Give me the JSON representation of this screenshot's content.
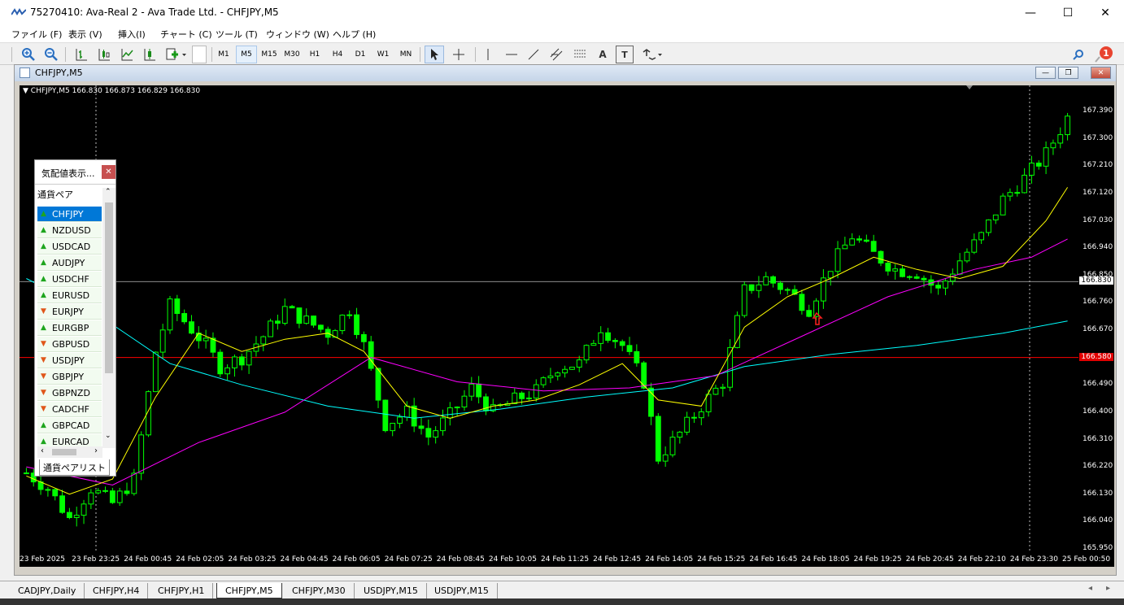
{
  "window": {
    "title": "75270410: Ava-Real 2 - Ava Trade Ltd. - CHFJPY,M5"
  },
  "menu": [
    "ファイル (F)",
    "表示 (V)",
    "挿入(I)",
    "チャート (C)",
    "ツール (T)",
    "ウィンドウ (W)",
    "ヘルプ (H)"
  ],
  "timeframes": [
    "M1",
    "M5",
    "M15",
    "M30",
    "H1",
    "H4",
    "D1",
    "W1",
    "MN"
  ],
  "active_timeframe": "M5",
  "tool_labels": {
    "text": "A",
    "label": "T"
  },
  "notification_count": "1",
  "chart_window": {
    "title": "CHFJPY,M5"
  },
  "chart": {
    "info": "CHFJPY,M5  166.830 166.873 166.829 166.830",
    "current_price": "166.830",
    "line_price": "166.580",
    "colors": {
      "bull": "#00ff00",
      "ma_fast": "#ffff00",
      "ma_mid": "#ff00ff",
      "ma_slow": "#00ffff",
      "hline": "#ff0000",
      "bid_line": "#c0c0c0"
    }
  },
  "chart_data": {
    "type": "candlestick",
    "symbol": "CHFJPY",
    "timeframe": "M5",
    "y_ticks": [
      "167.390",
      "167.300",
      "167.210",
      "167.120",
      "167.030",
      "166.940",
      "166.850",
      "166.760",
      "166.670",
      "166.580",
      "166.490",
      "166.400",
      "166.310",
      "166.220",
      "166.130",
      "166.040",
      "165.950"
    ],
    "ylim": [
      165.95,
      167.39
    ],
    "x_ticks": [
      "23 Feb 2025",
      "23 Feb 23:25",
      "24 Feb 00:45",
      "24 Feb 02:05",
      "24 Feb 03:25",
      "24 Feb 04:45",
      "24 Feb 06:05",
      "24 Feb 07:25",
      "24 Feb 08:45",
      "24 Feb 10:05",
      "24 Feb 11:25",
      "24 Feb 12:45",
      "24 Feb 14:05",
      "24 Feb 15:25",
      "24 Feb 16:45",
      "24 Feb 18:05",
      "24 Feb 19:25",
      "24 Feb 20:45",
      "24 Feb 22:10",
      "24 Feb 23:30",
      "25 Feb 00:50"
    ],
    "price_path": [
      [
        0,
        166.2
      ],
      [
        3,
        166.15
      ],
      [
        6,
        166.05
      ],
      [
        9,
        166.15
      ],
      [
        12,
        166.1
      ],
      [
        15,
        166.18
      ],
      [
        18,
        166.6
      ],
      [
        20,
        166.75
      ],
      [
        22,
        166.7
      ],
      [
        25,
        166.62
      ],
      [
        27,
        166.55
      ],
      [
        30,
        166.58
      ],
      [
        33,
        166.65
      ],
      [
        36,
        166.74
      ],
      [
        39,
        166.7
      ],
      [
        42,
        166.66
      ],
      [
        45,
        166.74
      ],
      [
        47,
        166.62
      ],
      [
        50,
        166.36
      ],
      [
        53,
        166.4
      ],
      [
        56,
        166.32
      ],
      [
        59,
        166.39
      ],
      [
        62,
        166.48
      ],
      [
        65,
        166.4
      ],
      [
        68,
        166.44
      ],
      [
        71,
        166.47
      ],
      [
        74,
        166.55
      ],
      [
        77,
        166.56
      ],
      [
        80,
        166.68
      ],
      [
        83,
        166.62
      ],
      [
        86,
        166.5
      ],
      [
        88,
        166.25
      ],
      [
        91,
        166.33
      ],
      [
        94,
        166.42
      ],
      [
        97,
        166.5
      ],
      [
        100,
        166.8
      ],
      [
        103,
        166.84
      ],
      [
        106,
        166.8
      ],
      [
        109,
        166.74
      ],
      [
        112,
        166.88
      ],
      [
        115,
        166.98
      ],
      [
        118,
        166.92
      ],
      [
        121,
        166.87
      ],
      [
        124,
        166.86
      ],
      [
        127,
        166.8
      ],
      [
        130,
        166.9
      ],
      [
        133,
        166.98
      ],
      [
        136,
        167.1
      ],
      [
        139,
        167.17
      ],
      [
        142,
        167.25
      ],
      [
        145,
        167.37
      ]
    ],
    "ma_fast": [
      [
        0,
        166.19
      ],
      [
        6,
        166.13
      ],
      [
        12,
        166.18
      ],
      [
        18,
        166.45
      ],
      [
        24,
        166.66
      ],
      [
        30,
        166.6
      ],
      [
        36,
        166.64
      ],
      [
        42,
        166.66
      ],
      [
        47,
        166.6
      ],
      [
        53,
        166.42
      ],
      [
        59,
        166.38
      ],
      [
        65,
        166.42
      ],
      [
        71,
        166.44
      ],
      [
        77,
        166.49
      ],
      [
        83,
        166.56
      ],
      [
        88,
        166.44
      ],
      [
        94,
        166.42
      ],
      [
        100,
        166.68
      ],
      [
        106,
        166.78
      ],
      [
        112,
        166.84
      ],
      [
        118,
        166.91
      ],
      [
        124,
        166.87
      ],
      [
        130,
        166.84
      ],
      [
        136,
        166.88
      ],
      [
        142,
        167.03
      ],
      [
        145,
        167.14
      ]
    ],
    "ma_mid": [
      [
        0,
        166.22
      ],
      [
        12,
        166.16
      ],
      [
        24,
        166.3
      ],
      [
        36,
        166.4
      ],
      [
        48,
        166.58
      ],
      [
        60,
        166.5
      ],
      [
        72,
        166.47
      ],
      [
        84,
        166.48
      ],
      [
        96,
        166.52
      ],
      [
        108,
        166.65
      ],
      [
        120,
        166.78
      ],
      [
        132,
        166.87
      ],
      [
        140,
        166.91
      ],
      [
        145,
        166.97
      ]
    ],
    "ma_slow": [
      [
        0,
        166.84
      ],
      [
        10,
        166.72
      ],
      [
        20,
        166.56
      ],
      [
        30,
        166.49
      ],
      [
        42,
        166.42
      ],
      [
        54,
        166.38
      ],
      [
        66,
        166.41
      ],
      [
        78,
        166.45
      ],
      [
        90,
        166.48
      ],
      [
        100,
        166.55
      ],
      [
        112,
        166.59
      ],
      [
        124,
        166.62
      ],
      [
        136,
        166.66
      ],
      [
        145,
        166.7
      ]
    ]
  },
  "market_watch": {
    "title": "気配値表示...",
    "column": "通貨ペア",
    "symbols": [
      {
        "name": "CHFJPY",
        "dir": "up",
        "selected": true
      },
      {
        "name": "NZDUSD",
        "dir": "up"
      },
      {
        "name": "USDCAD",
        "dir": "up"
      },
      {
        "name": "AUDJPY",
        "dir": "up"
      },
      {
        "name": "USDCHF",
        "dir": "up"
      },
      {
        "name": "EURUSD",
        "dir": "up"
      },
      {
        "name": "EURJPY",
        "dir": "down"
      },
      {
        "name": "EURGBP",
        "dir": "up"
      },
      {
        "name": "GBPUSD",
        "dir": "down"
      },
      {
        "name": "USDJPY",
        "dir": "down"
      },
      {
        "name": "GBPJPY",
        "dir": "down"
      },
      {
        "name": "GBPNZD",
        "dir": "down"
      },
      {
        "name": "CADCHF",
        "dir": "down"
      },
      {
        "name": "GBPCAD",
        "dir": "up"
      },
      {
        "name": "EURCAD",
        "dir": "up"
      }
    ],
    "tab": "通貨ペアリスト"
  },
  "chart_tabs": [
    "CADJPY,Daily",
    "CHFJPY,H4",
    "CHFJPY,H1",
    "CHFJPY,M5",
    "CHFJPY,M30",
    "USDJPY,M15",
    "USDJPY,M15"
  ],
  "active_tab": "CHFJPY,M5"
}
